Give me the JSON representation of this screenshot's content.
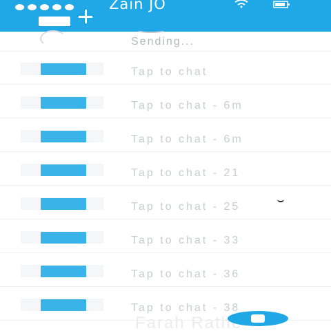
{
  "status_bar": {
    "carrier": "Zain JO",
    "signal_icon": "signal-dots-icon",
    "wifi_icon": "wifi-icon",
    "battery_icon": "battery-icon"
  },
  "header": {
    "compose_icon": "new-chat-plus-icon"
  },
  "chats": {
    "first_status": "Sending...",
    "items": [
      {
        "caption": "Tap to chat"
      },
      {
        "caption": "Tap to chat - 6m"
      },
      {
        "caption": "Tap to chat - 6m"
      },
      {
        "caption": "Tap to chat - 21"
      },
      {
        "caption": "Tap to chat - 25"
      },
      {
        "caption": "Tap to chat - 33"
      },
      {
        "caption": "Tap to chat - 36"
      },
      {
        "caption": "Tap to chat - 38"
      }
    ],
    "last_partial": "Farah Rathe"
  },
  "colors": {
    "accent": "#1fa7e6",
    "bubble": "#3ab3e8",
    "text_faded": "#c9cccf"
  }
}
